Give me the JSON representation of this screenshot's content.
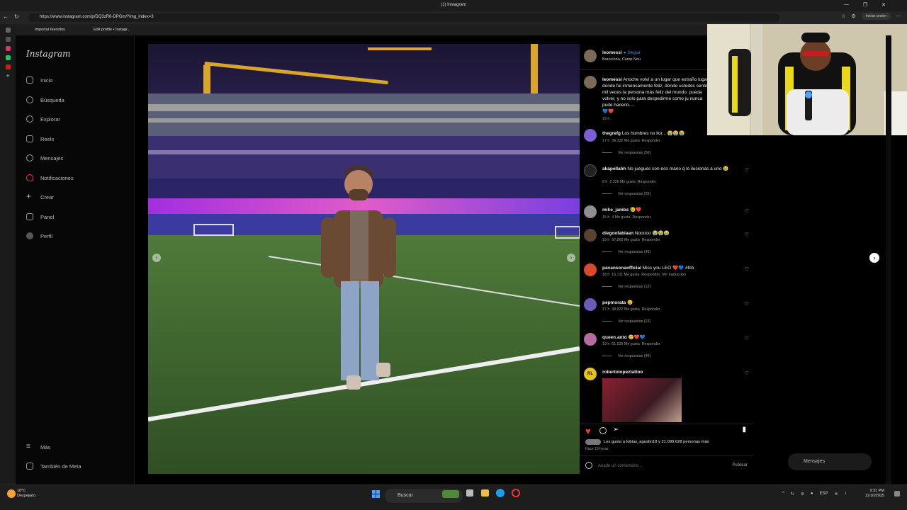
{
  "window": {
    "title": "(1) Instagram"
  },
  "browser": {
    "url": "https://www.instagram.com/p/DQ3zR6-DPGm/?img_index=3",
    "login_label": "Iniciar sesión"
  },
  "favorites": [
    {
      "label": "Importar favoritos"
    },
    {
      "label": "Edit profile • Instagr..."
    }
  ],
  "sidebar": {
    "logo": "Instagram",
    "items": [
      {
        "label": "Inicio",
        "icon": "home-icon"
      },
      {
        "label": "Búsqueda",
        "icon": "search-icon"
      },
      {
        "label": "Explorar",
        "icon": "compass-icon"
      },
      {
        "label": "Reels",
        "icon": "reels-icon"
      },
      {
        "label": "Mensajes",
        "icon": "messenger-icon"
      },
      {
        "label": "Notificaciones",
        "icon": "heart-icon"
      },
      {
        "label": "Crear",
        "icon": "plus-icon"
      },
      {
        "label": "Panel",
        "icon": "chart-icon"
      },
      {
        "label": "Perfil",
        "icon": "avatar-icon"
      }
    ],
    "bottom": [
      {
        "label": "Más",
        "icon": "menu-icon"
      },
      {
        "label": "También de Meta",
        "icon": "meta-icon"
      }
    ]
  },
  "post": {
    "author": "leomessi",
    "follow": "Seguir",
    "location": "Barcelona, Camp Nou",
    "caption": "Anoche volví a un lugar que extraño lugar donde fui inmensamente feliz, donde ustedes sentir mil veces la persona más feliz del mundo. pueda volver, y no solo para despedirme como ju nunca pude hacerlo...",
    "caption_emoji": "💙❤️",
    "caption_time": "19 h",
    "likes_text": "Les gusta a tobias_agustin18 y 21.090.628 personas más",
    "posted": "Hace 19 horas",
    "comment_placeholder": "Añade un comentario...",
    "publish": "Publicar"
  },
  "comments": [
    {
      "user": "thegrefg",
      "text": "Los hombres no llor... 😭😭😭",
      "time": "17 h",
      "likes": "36.332 Me gusta",
      "reply": "Responder",
      "replies": "Ver respuestas (56)"
    },
    {
      "user": "akapellahh",
      "text": "No juegues con eso mano q lo ilusionas a uno 😢",
      "time": "8 h",
      "likes": "2.326 Me gusta",
      "reply": "Responder",
      "replies": "Ver respuestas (25)"
    },
    {
      "user": "mike_jambs",
      "text": "😢❤️",
      "time": "15 h",
      "likes": "4 Me gusta",
      "reply": "Responder",
      "replies": ""
    },
    {
      "user": "diegoofabiaan",
      "text": "Nooooo 😭😭😭",
      "time": "19 h",
      "likes": "97.860 Me gusta",
      "reply": "Responder",
      "replies": "Ver respuestas (43)"
    },
    {
      "user": "pavansonaofficial",
      "text": "Miss you LEO ❤️💙 #fcb",
      "time": "18 h",
      "likes": "16.711 Me gusta",
      "reply": "Responder",
      "translate": "Ver traducción",
      "replies": "Ver respuestas (12)"
    },
    {
      "user": "pepmorata",
      "text": "😢",
      "time": "17 h",
      "likes": "38.822 Me gusta",
      "reply": "Responder",
      "replies": "Ver respuestas (23)"
    },
    {
      "user": "queen.anto",
      "text": "😢❤️💙",
      "time": "19 h",
      "likes": "51.539 Me gusta",
      "reply": "Responder",
      "replies": "Ver respuestas (45)"
    },
    {
      "user": "robertolopeztattoo",
      "text": "",
      "time": "",
      "likes": "",
      "reply": "",
      "replies": ""
    }
  ],
  "floating": {
    "messages": "Mensajes"
  },
  "taskbar": {
    "temp": "18°C",
    "weather": "Despejado",
    "search": "Buscar",
    "lang": "ESP",
    "time": "9:31 PM",
    "date": "11/10/2025"
  },
  "colors": {
    "accent": "#0095f6",
    "like": "#ff3040"
  }
}
